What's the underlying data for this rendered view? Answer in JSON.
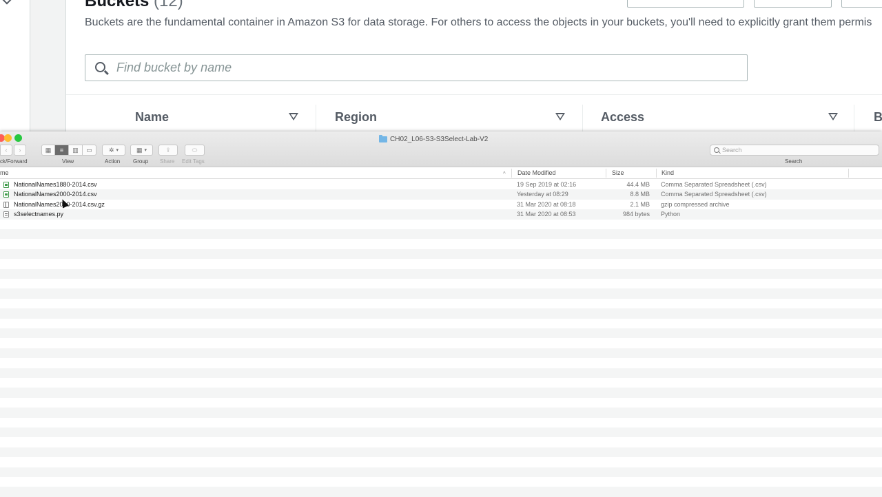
{
  "aws": {
    "title": "Buckets",
    "count": "(12)",
    "description": "Buckets are the fundamental container in Amazon S3 for data storage. For others to access the objects in your buckets, you'll need to explicitly grant them permis",
    "search_placeholder": "Find bucket by name",
    "columns": [
      "Name",
      "Region",
      "Access",
      "B"
    ]
  },
  "finder": {
    "window_title": "CH02_L06-S3-S3Select-Lab-V2",
    "toolbar": {
      "back_forward_label": "ck/Forward",
      "view_label": "View",
      "action_label": "Action",
      "group_label": "Group",
      "share_label": "Share",
      "edit_tags_label": "Edit Tags",
      "search_label": "Search",
      "search_placeholder": "Search"
    },
    "columns": {
      "name": "me",
      "date": "Date Modified",
      "size": "Size",
      "kind": "Kind"
    },
    "files": [
      {
        "name": "NationalNames1880-2014.csv",
        "date": "19 Sep 2019 at 02:16",
        "size": "44.4 MB",
        "kind": "Comma Separated Spreadsheet (.csv)",
        "icon": "csv-file-icon"
      },
      {
        "name": "NationalNames2000-2014.csv",
        "date": "Yesterday at 08:29",
        "size": "8.8 MB",
        "kind": "Comma Separated Spreadsheet (.csv)",
        "icon": "csv-file-icon"
      },
      {
        "name": "NationalNames2000-2014.csv.gz",
        "date": "31 Mar 2020 at 08:18",
        "size": "2.1 MB",
        "kind": "gzip compressed archive",
        "icon": "archive-file-icon"
      },
      {
        "name": "s3selectnames.py",
        "date": "31 Mar 2020 at 08:53",
        "size": "984 bytes",
        "kind": "Python",
        "icon": "python-file-icon"
      }
    ]
  },
  "colors": {
    "close": "#fe5f57",
    "minimize": "#febc2e",
    "zoom": "#28c840",
    "stripe": "#f4f5f5"
  }
}
